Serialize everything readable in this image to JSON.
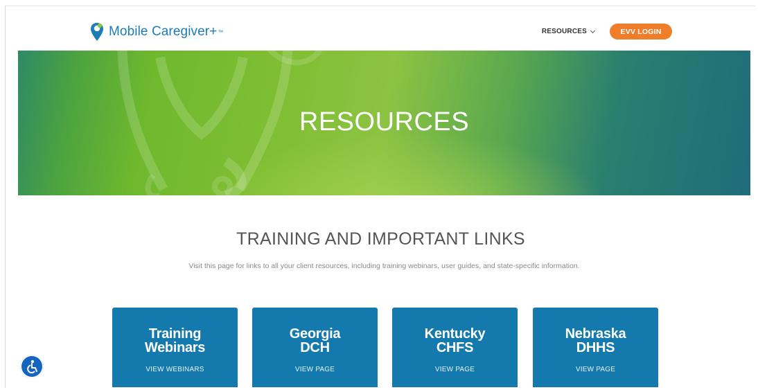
{
  "header": {
    "logo_text": "Mobile Caregiver+",
    "logo_tm": "™",
    "nav_resources": "RESOURCES",
    "evv_login": "EVV LOGIN"
  },
  "hero": {
    "title": "RESOURCES"
  },
  "section": {
    "title": "TRAINING AND IMPORTANT LINKS",
    "subtitle": "Visit this page for links to all your client resources, including training webinars, user guides, and state-specific information."
  },
  "cards": [
    {
      "line1": "Training",
      "line2": "Webinars",
      "link": "VIEW WEBINARS"
    },
    {
      "line1": "Georgia",
      "line2": "DCH",
      "link": "VIEW PAGE"
    },
    {
      "line1": "Kentucky",
      "line2": "CHFS",
      "link": "VIEW PAGE"
    },
    {
      "line1": "Nebraska",
      "line2": "DHHS",
      "link": "VIEW PAGE"
    }
  ],
  "icons": {
    "logo": "map-pin-icon",
    "accessibility": "accessibility-icon",
    "dropdown": "chevron-down-icon"
  },
  "colors": {
    "brand_blue": "#1d7bb5",
    "card_blue": "#1479ad",
    "evv_orange": "#ef7e2b",
    "hero_green": "#7fbe33",
    "hero_teal": "#1f6c7a",
    "a11y_blue": "#1565c0"
  }
}
